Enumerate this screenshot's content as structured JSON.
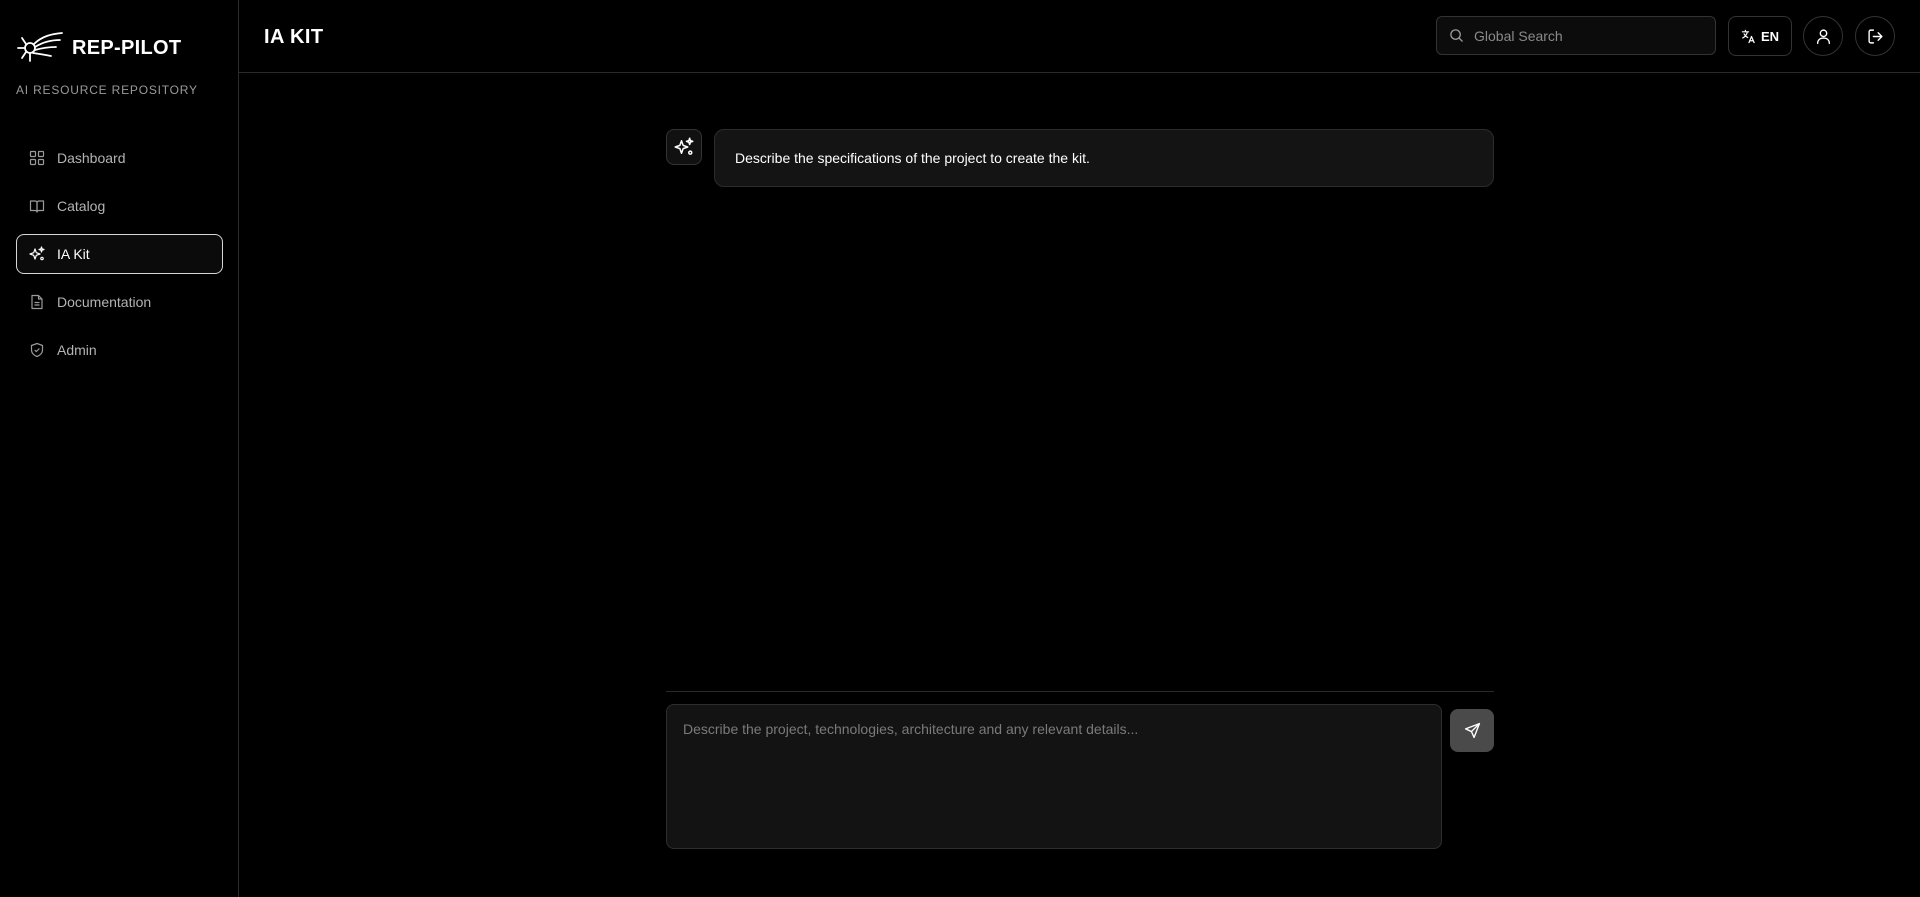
{
  "brand": {
    "name": "REP-PILOT",
    "tagline": "AI RESOURCE REPOSITORY"
  },
  "sidebar": {
    "items": [
      {
        "label": "Dashboard",
        "icon": "grid-icon",
        "active": false
      },
      {
        "label": "Catalog",
        "icon": "book-icon",
        "active": false
      },
      {
        "label": "IA Kit",
        "icon": "sparkles-icon",
        "active": true
      },
      {
        "label": "Documentation",
        "icon": "document-icon",
        "active": false
      },
      {
        "label": "Admin",
        "icon": "shield-icon",
        "active": false
      }
    ]
  },
  "header": {
    "title": "IA KIT",
    "search_placeholder": "Global Search",
    "language": "EN"
  },
  "chat": {
    "messages": [
      {
        "role": "assistant",
        "text": "Describe the specifications of the project to create the kit."
      }
    ],
    "input_placeholder": "Describe the project, technologies, architecture and any relevant details..."
  },
  "colors": {
    "background": "#000000",
    "panel": "#141414",
    "border": "#2a2a2a",
    "send_button": "#4a4a4a"
  }
}
